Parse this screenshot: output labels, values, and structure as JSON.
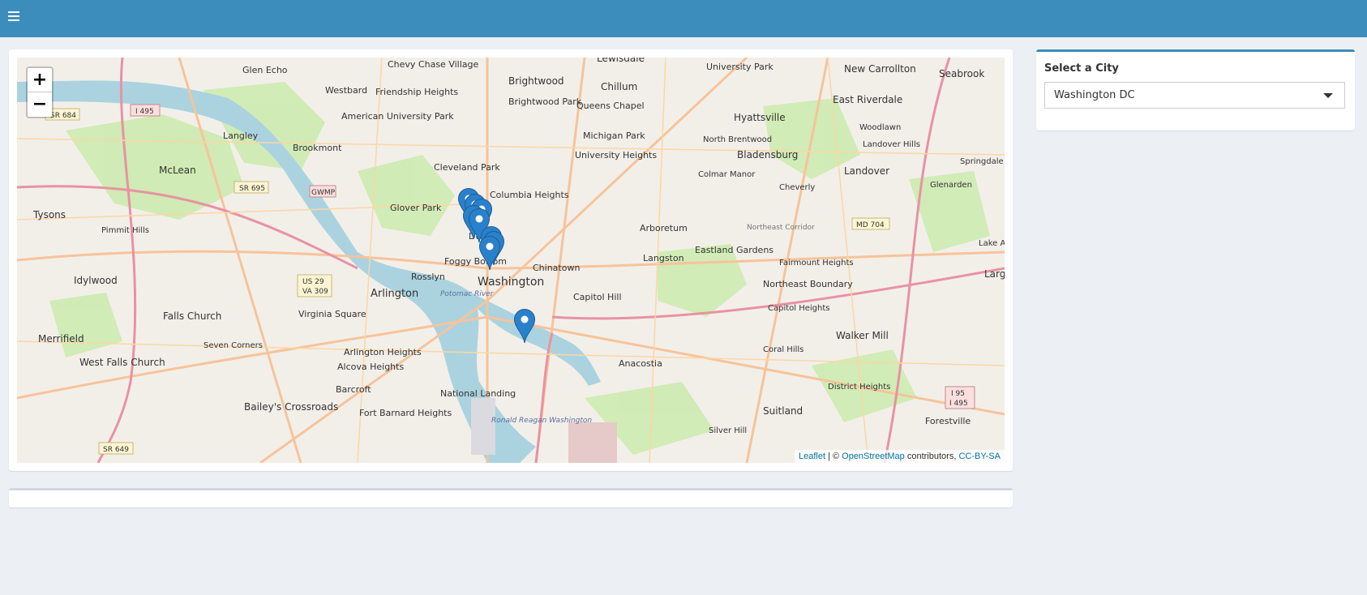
{
  "header": {
    "menu_icon": "hamburger-icon",
    "color": "#3c8dbc"
  },
  "map": {
    "zoom_in": "+",
    "zoom_out": "−",
    "attribution": {
      "leaflet": "Leaflet",
      "sep": " | © ",
      "osm": "OpenStreetMap",
      "contrib": " contributors, ",
      "license": "CC-BY-SA"
    },
    "labels": {
      "l1": "Lewisdale",
      "l2": "University Park",
      "l3": "New Carrollton",
      "l4": "Seabrook",
      "l5": "Glen Echo",
      "l6": "Chevy Chase Village",
      "l7": "Brightwood",
      "l8": "Chillum",
      "l9": "Westbard",
      "l10": "Friendship Heights",
      "l11": "Brightwood Park",
      "l12": "Queens Chapel",
      "l13": "Hyattsville",
      "l14": "East Riverdale",
      "l15": "American University Park",
      "l16": "Michigan Park",
      "l17": "North Brentwood",
      "l18": "Woodlawn",
      "l19": "Langley",
      "l20": "Brookmont",
      "l21": "University Heights",
      "l22": "Bladensburg",
      "l23": "Landover Hills",
      "l24": "Springdale",
      "l25": "Cleveland Park",
      "l26": "Colmar Manor",
      "l27": "McLean",
      "l28": "Landover",
      "l29": "Glenarden",
      "l30": "Cheverly",
      "l31": "Columbia Heights",
      "l32": "Glover Park",
      "l33": "Tysons",
      "l34": "Arboretum",
      "l35": "Northeast Corridor",
      "l36": "Pimmit Hills",
      "l37": "Dupont",
      "l38": "Eastland Gardens",
      "l39": "Foggy Bottom",
      "l40": "Chinatown",
      "l41": "Langston",
      "l42": "Fairmount Heights",
      "l43": "Idylwood",
      "l44": "Rosslyn",
      "l45": "Washington",
      "l46": "Northeast Boundary",
      "l47": "Arlington",
      "l48": "Potomac River",
      "l49": "Capitol Hill",
      "l50": "Falls Church",
      "l51": "Virginia Square",
      "l52": "Capitol Heights",
      "l53": "Merrifield",
      "l54": "Walker Mill",
      "l55": "Seven Corners",
      "l56": "Arlington Heights",
      "l57": "Anacostia",
      "l58": "Coral Hills",
      "l59": "West Falls Church",
      "l60": "Alcova Heights",
      "l61": "District Heights",
      "l62": "Barcroft",
      "l63": "National Landing",
      "l64": "Bailey's Crossroads",
      "l65": "Fort Barnard Heights",
      "l66": "Suitland",
      "l67": "Forestville",
      "l68": "Ronald Reagan Washington",
      "l69": "Silver Hill",
      "l70": "Lake A",
      "l71": "Larg"
    },
    "shields": {
      "s1": "SR 684",
      "s2": "I 495",
      "s3": "SR 695",
      "s4": "GWMP",
      "s5": "MD 704",
      "s6": "US 29",
      "s7": "VA 309",
      "s8": "I 95",
      "s9": "I 495",
      "s10": "SR 649"
    },
    "marker_color": "#2a81cb",
    "markers": 9
  },
  "sidebar": {
    "label": "Select a City",
    "selected": "Washington DC"
  }
}
